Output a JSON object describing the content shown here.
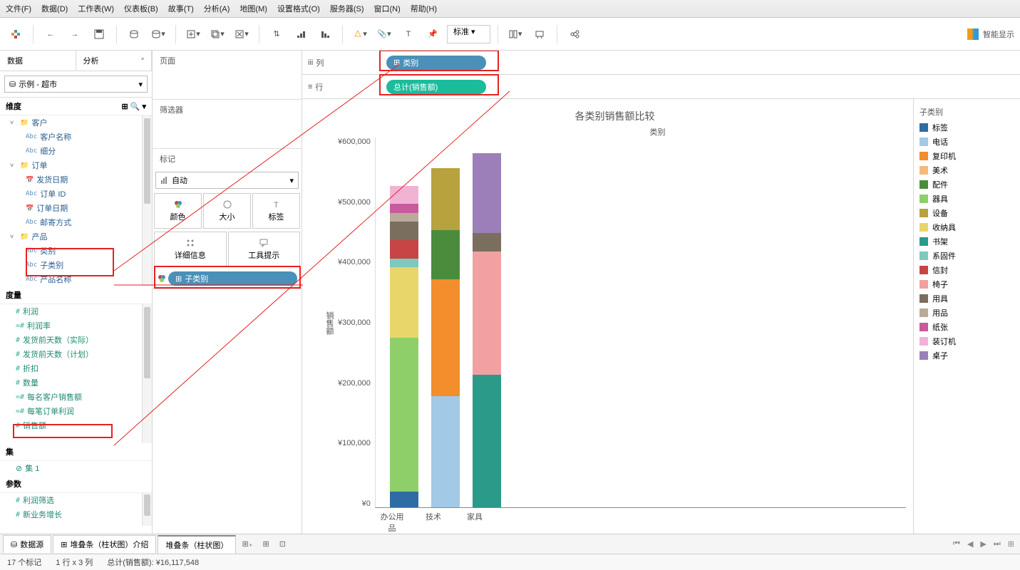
{
  "menu": [
    "文件(F)",
    "数据(D)",
    "工作表(W)",
    "仪表板(B)",
    "故事(T)",
    "分析(A)",
    "地图(M)",
    "设置格式(O)",
    "服务器(S)",
    "窗口(N)",
    "帮助(H)"
  ],
  "toolbar": {
    "std_label": "标准",
    "show_me": "智能显示"
  },
  "sidebar": {
    "tab_data": "数据",
    "tab_analytics": "分析",
    "datasource": "示例 - 超市",
    "sec_dim": "维度",
    "sec_meas": "度量",
    "sec_set": "集",
    "sec_param": "参数",
    "dim_tree": [
      {
        "type": "folder",
        "label": "客户"
      },
      {
        "type": "abc",
        "label": "客户名称",
        "child": true
      },
      {
        "type": "abc",
        "label": "细分",
        "child": true
      },
      {
        "type": "folder",
        "label": "订单"
      },
      {
        "type": "cal",
        "label": "发货日期",
        "child": true
      },
      {
        "type": "abc",
        "label": "订单 ID",
        "child": true
      },
      {
        "type": "cal",
        "label": "订单日期",
        "child": true
      },
      {
        "type": "abc",
        "label": "邮寄方式",
        "child": true
      },
      {
        "type": "hier",
        "label": "产品"
      },
      {
        "type": "abc",
        "label": "类别",
        "child": true
      },
      {
        "type": "abc",
        "label": "子类别",
        "child": true
      },
      {
        "type": "abc",
        "label": "产品名称",
        "child": true
      }
    ],
    "meas_tree": [
      {
        "type": "hash",
        "label": "利润"
      },
      {
        "type": "hashc",
        "label": "利润率"
      },
      {
        "type": "hash",
        "label": "发货前天数（实际）"
      },
      {
        "type": "hash",
        "label": "发货前天数（计划）"
      },
      {
        "type": "hash",
        "label": "折扣"
      },
      {
        "type": "hash",
        "label": "数量"
      },
      {
        "type": "hashc",
        "label": "每名客户销售额"
      },
      {
        "type": "hashc",
        "label": "每笔订单利润"
      },
      {
        "type": "hash",
        "label": "销售额"
      }
    ],
    "set_tree": [
      {
        "label": "集 1"
      }
    ],
    "param_tree": [
      {
        "label": "利润筛选"
      },
      {
        "label": "新业务增长"
      }
    ]
  },
  "cards": {
    "pages": "页面",
    "filters": "筛选器",
    "marks": "标记",
    "mark_type": "自动",
    "mark_btns": [
      "颜色",
      "大小",
      "标签",
      "详细信息",
      "工具提示"
    ],
    "color_pill": "子类别"
  },
  "shelves": {
    "columns": "列",
    "rows": "行",
    "col_pill": "类别",
    "row_pill": "总计(销售额)"
  },
  "chart": {
    "title": "各类别销售额比较",
    "xlabel": "类别",
    "ylabel": "销售额",
    "categories": [
      "办公用品",
      "技术",
      "家具"
    ],
    "yticks": [
      "¥600,000",
      "¥500,000",
      "¥400,000",
      "¥300,000",
      "¥200,000",
      "¥100,000",
      "¥0"
    ]
  },
  "legend": {
    "title": "子类别",
    "items": [
      {
        "label": "标签",
        "color": "#2e6ca4"
      },
      {
        "label": "电话",
        "color": "#a2c9e6"
      },
      {
        "label": "复印机",
        "color": "#f28e2b"
      },
      {
        "label": "美术",
        "color": "#f7b97a"
      },
      {
        "label": "配件",
        "color": "#4a8c3c"
      },
      {
        "label": "器具",
        "color": "#8fcf6a"
      },
      {
        "label": "设备",
        "color": "#b8a23e"
      },
      {
        "label": "收纳具",
        "color": "#e9d66b"
      },
      {
        "label": "书架",
        "color": "#2b9a89"
      },
      {
        "label": "系固件",
        "color": "#7ec8bd"
      },
      {
        "label": "信封",
        "color": "#c84545"
      },
      {
        "label": "椅子",
        "color": "#f1a1a1"
      },
      {
        "label": "用具",
        "color": "#7a6e5f"
      },
      {
        "label": "用品",
        "color": "#b8ab9a"
      },
      {
        "label": "纸张",
        "color": "#c85a9e"
      },
      {
        "label": "装订机",
        "color": "#f1b3d4"
      },
      {
        "label": "桌子",
        "color": "#9c7fb8"
      }
    ]
  },
  "chart_data": {
    "type": "bar-stacked",
    "title": "各类别销售额比较",
    "xlabel": "类别",
    "ylabel": "销售额",
    "ylim": [
      0,
      600000
    ],
    "categories": [
      "办公用品",
      "技术",
      "家具"
    ],
    "series": [
      {
        "name": "标签",
        "values": [
          25000,
          0,
          0
        ],
        "color": "#2e6ca4"
      },
      {
        "name": "电话",
        "values": [
          0,
          180000,
          0
        ],
        "color": "#a2c9e6"
      },
      {
        "name": "复印机",
        "values": [
          0,
          190000,
          0
        ],
        "color": "#f28e2b"
      },
      {
        "name": "美术",
        "values": [
          0,
          0,
          0
        ],
        "color": "#f7b97a"
      },
      {
        "name": "配件",
        "values": [
          0,
          80000,
          0
        ],
        "color": "#4a8c3c"
      },
      {
        "name": "器具",
        "values": [
          250000,
          0,
          0
        ],
        "color": "#8fcf6a"
      },
      {
        "name": "设备",
        "values": [
          0,
          100000,
          0
        ],
        "color": "#b8a23e"
      },
      {
        "name": "收纳具",
        "values": [
          115000,
          0,
          0
        ],
        "color": "#e9d66b"
      },
      {
        "name": "书架",
        "values": [
          0,
          0,
          215000
        ],
        "color": "#2b9a89"
      },
      {
        "name": "系固件",
        "values": [
          14000,
          0,
          0
        ],
        "color": "#7ec8bd"
      },
      {
        "name": "信封",
        "values": [
          30000,
          0,
          0
        ],
        "color": "#c84545"
      },
      {
        "name": "椅子",
        "values": [
          0,
          0,
          200000
        ],
        "color": "#f1a1a1"
      },
      {
        "name": "用具",
        "values": [
          30000,
          0,
          30000
        ],
        "color": "#7a6e5f"
      },
      {
        "name": "用品",
        "values": [
          14000,
          0,
          0
        ],
        "color": "#b8ab9a"
      },
      {
        "name": "纸张",
        "values": [
          14000,
          0,
          0
        ],
        "color": "#c85a9e"
      },
      {
        "name": "装订机",
        "values": [
          30000,
          0,
          0
        ],
        "color": "#f1b3d4"
      },
      {
        "name": "桌子",
        "values": [
          0,
          0,
          130000
        ],
        "color": "#9c7fb8"
      }
    ]
  },
  "btabs": {
    "data_source": "数据源",
    "t1": "堆叠条（柱状图）介绍",
    "t2": "堆叠条（柱状图）"
  },
  "status": {
    "marks": "17 个标记",
    "rc": "1 行 x 3 列",
    "sum": "总计(销售额): ¥16,117,548"
  }
}
